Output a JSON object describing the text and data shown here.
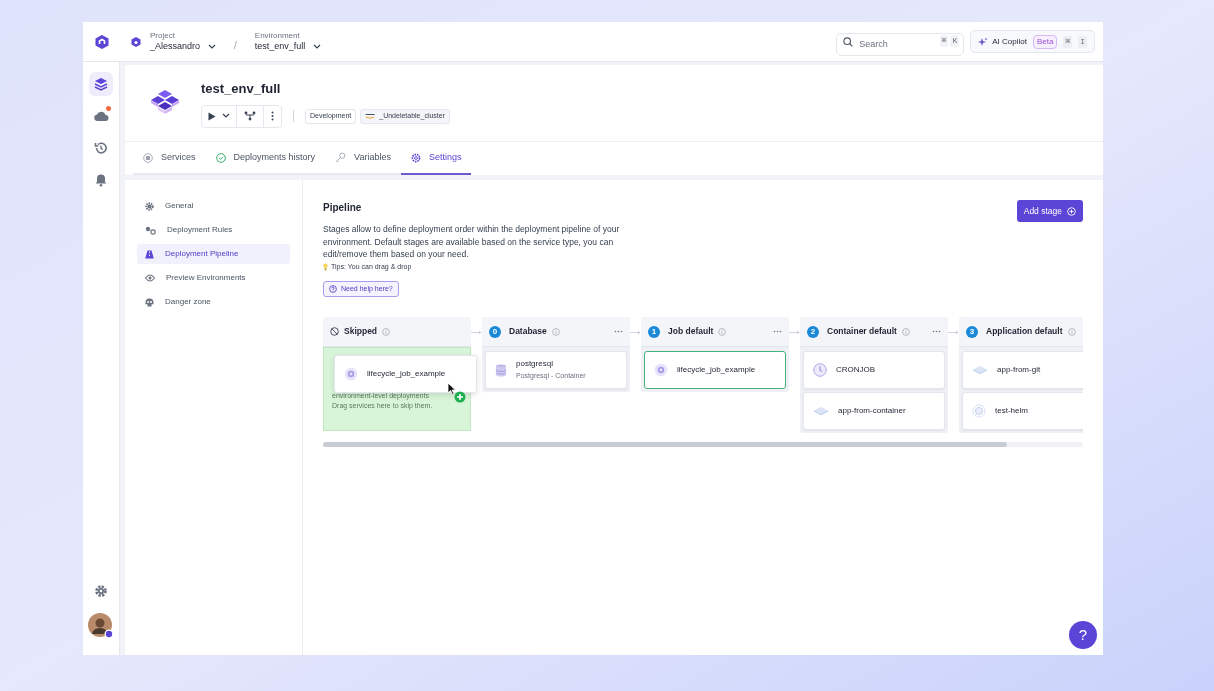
{
  "topbar": {
    "project_label": "Project",
    "project_name": "_Alessandro",
    "separator": "/",
    "environment_label": "Environment",
    "environment_name": "test_env_full",
    "search": {
      "placeholder": "Search",
      "keys": [
        "⌘",
        "K"
      ]
    },
    "copilot": {
      "label": "AI Copilot",
      "badge": "Beta",
      "keys": [
        "⌘",
        "I"
      ]
    }
  },
  "rail": {
    "items": [
      {
        "kind": "layers",
        "selected": true,
        "notification": false
      },
      {
        "kind": "cloud",
        "selected": false,
        "notification": true
      },
      {
        "kind": "history",
        "selected": false,
        "notification": false
      },
      {
        "kind": "bell",
        "selected": false,
        "notification": false
      }
    ],
    "bottom": [
      {
        "kind": "settings"
      },
      {
        "kind": "avatar"
      }
    ]
  },
  "environment": {
    "title": "test_env_full",
    "tags": [
      {
        "kind": "plain",
        "label": "Development"
      },
      {
        "kind": "cluster",
        "label": "_Undeletable_cluster"
      }
    ]
  },
  "tabs": [
    {
      "label": "Services",
      "selected": false
    },
    {
      "label": "Deployments history",
      "selected": false
    },
    {
      "label": "Variables",
      "selected": false
    },
    {
      "label": "Settings",
      "selected": true
    }
  ],
  "settings_nav": [
    {
      "label": "General",
      "selected": false
    },
    {
      "label": "Deployment Rules",
      "selected": false
    },
    {
      "label": "Deployment Pipeline",
      "selected": true
    },
    {
      "label": "Preview Environments",
      "selected": false
    },
    {
      "label": "Danger zone",
      "selected": false
    }
  ],
  "pipeline": {
    "title": "Pipeline",
    "description": "Stages allow to define deployment order within the deployment pipeline of your environment. Default stages are available based on the service type, you can edit/remove them based on your need.",
    "tip": "Tips: You can drag & drop",
    "help_button": "Need help here?",
    "add_button": "Add stage",
    "stages": [
      {
        "kind": "skipped",
        "name": "Skipped",
        "hint": [
          "environment-level deployments",
          "Drag services here to skip them."
        ]
      },
      {
        "kind": "stage",
        "index": "0",
        "name": "Database",
        "services": [
          {
            "name": "postgresql",
            "subtitle": "Postgresql - Container",
            "kind": "database",
            "highlighted": false
          }
        ]
      },
      {
        "kind": "stage",
        "index": "1",
        "name": "Job default",
        "services": [
          {
            "name": "lifecycle_job_example",
            "kind": "job",
            "highlighted": true
          }
        ]
      },
      {
        "kind": "stage",
        "index": "2",
        "name": "Container default",
        "services": [
          {
            "name": "CRONJOB",
            "kind": "cron",
            "highlighted": false
          },
          {
            "name": "app-from-container",
            "kind": "container",
            "highlighted": false
          }
        ]
      },
      {
        "kind": "stage",
        "index": "3",
        "name": "Application default",
        "services": [
          {
            "name": "app-from-git",
            "kind": "container",
            "highlighted": false
          },
          {
            "name": "test-helm",
            "kind": "helm",
            "highlighted": false
          }
        ]
      }
    ],
    "dragged_card": {
      "name": "lifecycle_job_example",
      "kind": "job"
    }
  },
  "help_fab": "?"
}
